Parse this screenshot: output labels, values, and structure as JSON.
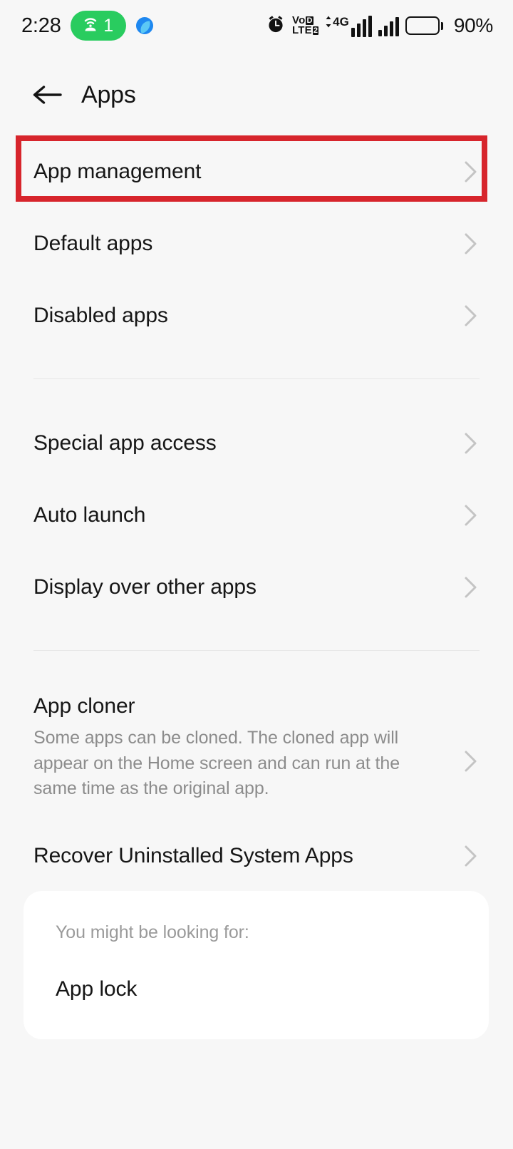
{
  "status_bar": {
    "clock": "2:28",
    "hotspot_count": "1",
    "hotspot_icon": "wifi-hotspot-icon",
    "blue_app_icon": "blue-leaf-app-icon",
    "alarm_icon": "alarm-clock-icon",
    "volte_line1": "Vo",
    "volte_line1_box": "D",
    "volte_line2": "LTE",
    "volte_line2_box": "2",
    "network_type": "4G",
    "signal_icon_1": "signal-bars-sim1-icon",
    "signal_icon_2": "signal-bars-sim2-icon",
    "battery_icon": "battery-icon",
    "battery_percent": "90%"
  },
  "app_bar": {
    "back_icon": "back-arrow-icon",
    "title": "Apps"
  },
  "colors": {
    "highlight_red": "#d7252c",
    "hotspot_green": "#29cc5f",
    "page_background": "#f7f7f7",
    "card_background": "#ffffff",
    "chevron_gray": "#c4c4c4"
  },
  "groups": [
    {
      "items": [
        {
          "label": "App management",
          "chevron_icon": "chevron-right-icon",
          "highlighted": true
        },
        {
          "label": "Default apps",
          "chevron_icon": "chevron-right-icon",
          "highlighted": false
        },
        {
          "label": "Disabled apps",
          "chevron_icon": "chevron-right-icon",
          "highlighted": false
        }
      ]
    },
    {
      "items": [
        {
          "label": "Special app access",
          "chevron_icon": "chevron-right-icon",
          "highlighted": false
        },
        {
          "label": "Auto launch",
          "chevron_icon": "chevron-right-icon",
          "highlighted": false
        },
        {
          "label": "Display over other apps",
          "chevron_icon": "chevron-right-icon",
          "highlighted": false
        }
      ]
    },
    {
      "items": [
        {
          "label": "App cloner",
          "description": "Some apps can be cloned. The cloned app will appear on the Home screen and can run at the same time as the original app.",
          "chevron_icon": "chevron-right-icon",
          "highlighted": false
        },
        {
          "label": "Recover Uninstalled System Apps",
          "chevron_icon": "chevron-right-icon",
          "highlighted": false
        }
      ]
    }
  ],
  "suggestion_card": {
    "title": "You might be looking for:",
    "items": [
      {
        "label": "App lock"
      }
    ]
  }
}
